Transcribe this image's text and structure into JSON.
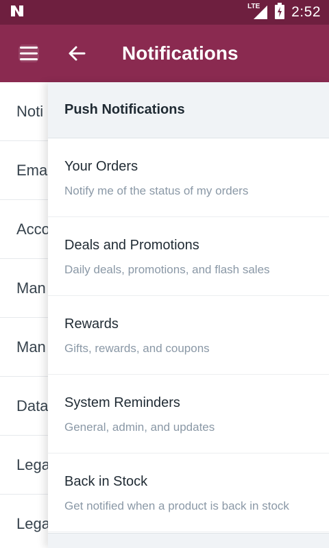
{
  "status_bar": {
    "time": "2:52",
    "network_label": "LTE",
    "icons": [
      "n-logo-icon",
      "signal-icon",
      "battery-charging-icon"
    ]
  },
  "app_bar": {
    "title": "Notifications",
    "icons": [
      "hamburger-menu-icon",
      "back-arrow-icon"
    ],
    "background_color": "#8a2a50"
  },
  "background_list": {
    "items": [
      "Noti",
      "Ema",
      "Acco",
      "Man",
      "Man",
      "Data",
      "Lega",
      "Lega"
    ]
  },
  "panel": {
    "header": "Push Notifications",
    "items": [
      {
        "title": "Your Orders",
        "description": "Notify me of the status of my orders"
      },
      {
        "title": "Deals and Promotions",
        "description": "Daily deals, promotions, and flash sales"
      },
      {
        "title": "Rewards",
        "description": "Gifts, rewards, and coupons"
      },
      {
        "title": "System Reminders",
        "description": "General, admin, and updates"
      },
      {
        "title": "Back in Stock",
        "description": "Get notified when a product is back in stock"
      }
    ]
  }
}
